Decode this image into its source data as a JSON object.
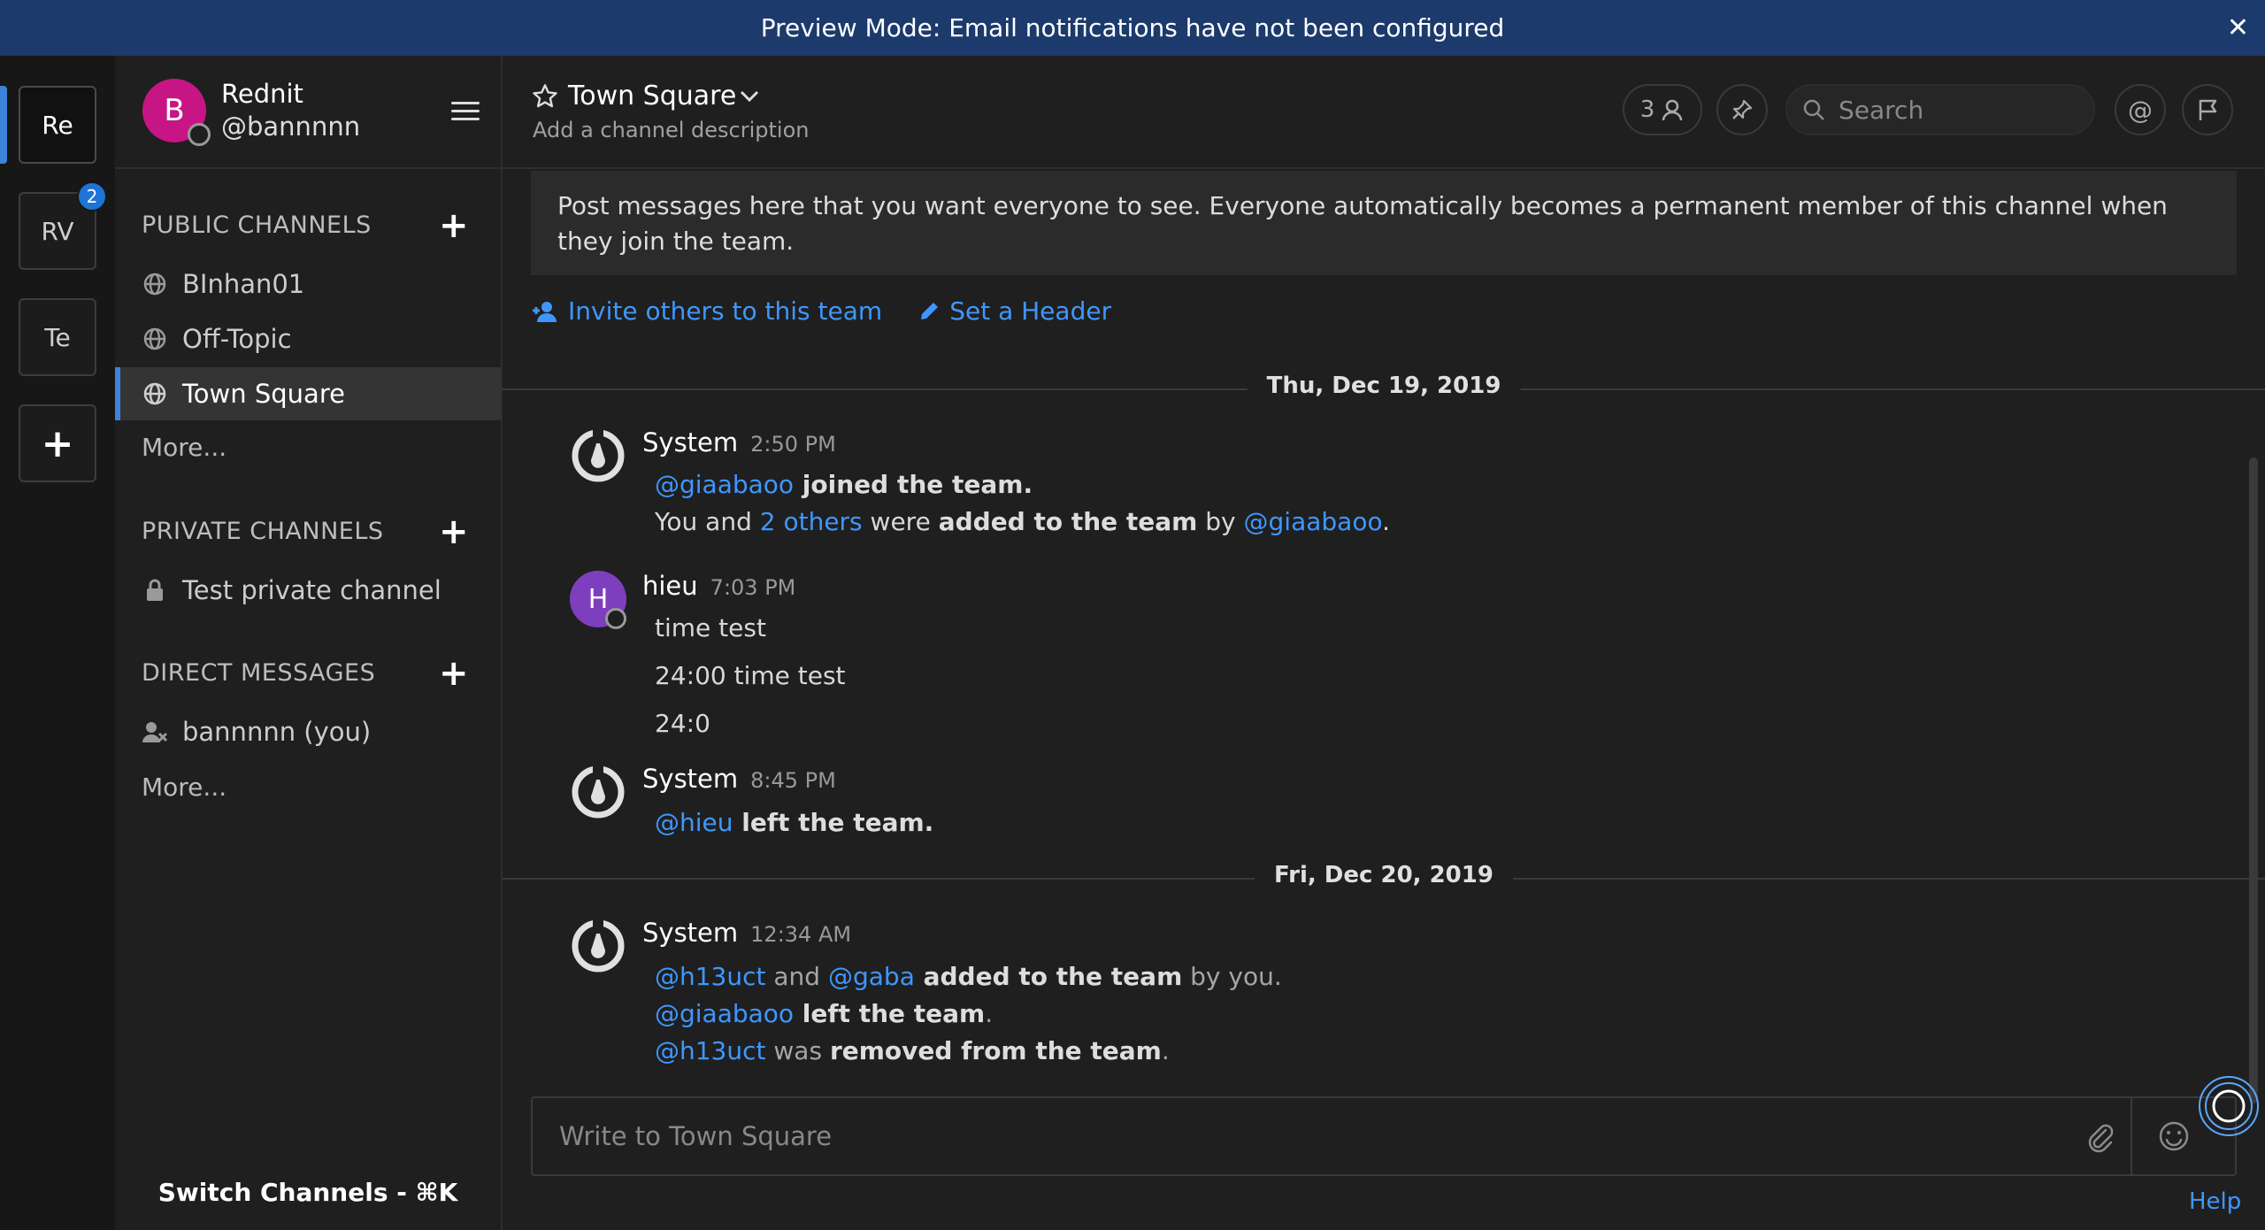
{
  "banner": {
    "text": "Preview Mode: Email notifications have not been configured",
    "close": "✕"
  },
  "teams": [
    {
      "initials": "Re",
      "active": true
    },
    {
      "initials": "RV",
      "badge": "2"
    },
    {
      "initials": "Te"
    }
  ],
  "team_add": "+",
  "user": {
    "avatar_letter": "B",
    "display_name": "Rednit",
    "username": "@bannnnn"
  },
  "sidebar": {
    "public_title": "PUBLIC CHANNELS",
    "public_channels": [
      "BInhan01",
      "Off-Topic",
      "Town Square"
    ],
    "public_more": "More...",
    "private_title": "PRIVATE CHANNELS",
    "private_channels": [
      "Test private channel"
    ],
    "dm_title": "DIRECT MESSAGES",
    "dms": [
      "bannnnn (you)"
    ],
    "dm_more": "More...",
    "switch_channels": "Switch Channels - ⌘K",
    "add": "+"
  },
  "channel": {
    "name": "Town Square",
    "description": "Add a channel description",
    "member_count": "3",
    "search_placeholder": "Search",
    "intro": "Post messages here that you want everyone to see. Everyone automatically becomes a permanent member of this channel when they join the team.",
    "invite": "Invite others to this team",
    "set_header": "Set a Header"
  },
  "dates": [
    "Thu, Dec 19, 2019",
    "Fri, Dec 20, 2019"
  ],
  "posts": {
    "p1": {
      "author": "System",
      "time": "2:50 PM",
      "l1_mention": "@giaabaoo",
      "l1_text": " joined the team.",
      "l2_a": "You and ",
      "l2_mention": "2 others",
      "l2_b": " were ",
      "l2_strong": "added to the team",
      "l2_c": " by ",
      "l2_mention2": "@giaabaoo",
      "l2_d": "."
    },
    "p2": {
      "author": "hieu",
      "avatar_letter": "H",
      "time": "7:03 PM",
      "lines": [
        "time test",
        "24:00 time test",
        "24:0"
      ]
    },
    "p3": {
      "author": "System",
      "time": "8:45 PM",
      "l1_mention": "@hieu",
      "l1_text": " left the team."
    },
    "p4": {
      "author": "System",
      "time": "12:34 AM",
      "l1_m1": "@h13uct",
      "l1_and": " and ",
      "l1_m2": "@gaba",
      "l1_strong": " added to the team",
      "l1_tail": " by you.",
      "l2_mention": "@giaabaoo",
      "l2_strong": " left the team",
      "l2_tail": ".",
      "l3_mention": "@h13uct",
      "l3_a": " was ",
      "l3_strong": "removed from the team",
      "l3_tail": "."
    }
  },
  "composer": {
    "placeholder": "Write to Town Square"
  },
  "help": "Help",
  "colors": {
    "accent": "#3e82d9",
    "link": "#3e97ff",
    "banner": "#1c3a6b",
    "avatar_b": "#c71585",
    "avatar_h": "#7e3fbf"
  }
}
